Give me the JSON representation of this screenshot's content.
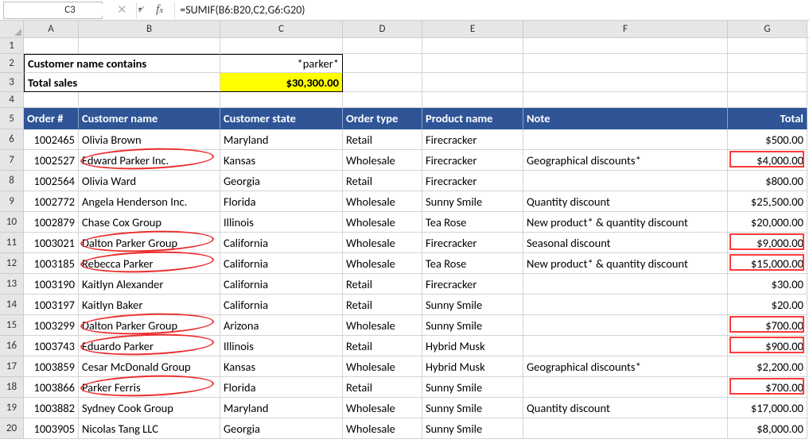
{
  "namebox": "C3",
  "formula": "=SUMIF(B6:B20,C2,G6:G20)",
  "colHeaders": [
    "A",
    "B",
    "C",
    "D",
    "E",
    "F",
    "G"
  ],
  "summary": {
    "label1": "Customer name contains",
    "value1": "*parker*",
    "label2": "Total sales",
    "value2": "$30,300.00"
  },
  "tableHeader": {
    "order": "Order #",
    "customer": "Customer name",
    "state": "Customer state",
    "type": "Order type",
    "product": "Product name",
    "note": "Note",
    "total": "Total"
  },
  "rows": [
    {
      "r": 6,
      "order": "1002465",
      "customer": "Olivia Brown",
      "state": "Maryland",
      "type": "Retail",
      "product": "Firecracker",
      "note": "",
      "total": "$500.00"
    },
    {
      "r": 7,
      "order": "1002527",
      "customer": "Edward Parker Inc.",
      "state": "Kansas",
      "type": "Wholesale",
      "product": "Firecracker",
      "note": "Geographical discounts*",
      "total": "$4,000.00",
      "ovCust": true,
      "ovTotal": true
    },
    {
      "r": 8,
      "order": "1002564",
      "customer": "Olivia Ward",
      "state": "Georgia",
      "type": "Retail",
      "product": "Firecracker",
      "note": "",
      "total": "$800.00"
    },
    {
      "r": 9,
      "order": "1002772",
      "customer": "Angela Henderson Inc.",
      "state": "Florida",
      "type": "Wholesale",
      "product": "Sunny Smile",
      "note": "Quantity discount",
      "total": "$25,500.00"
    },
    {
      "r": 10,
      "order": "1002879",
      "customer": "Chase Cox Group",
      "state": "Illinois",
      "type": "Wholesale",
      "product": "Tea Rose",
      "note": "New product* & quantity discount",
      "total": "$20,000.00"
    },
    {
      "r": 11,
      "order": "1003021",
      "customer": "Dalton Parker Group",
      "state": "California",
      "type": "Wholesale",
      "product": "Firecracker",
      "note": "Seasonal discount",
      "total": "$9,000.00",
      "ovCust": true,
      "ovTotal": true
    },
    {
      "r": 12,
      "order": "1003185",
      "customer": "Rebecca Parker",
      "state": "California",
      "type": "Wholesale",
      "product": "Tea Rose",
      "note": "New product* & quantity discount",
      "total": "$15,000.00",
      "ovCust": true,
      "ovTotal": true
    },
    {
      "r": 13,
      "order": "1003190",
      "customer": "Kaitlyn Alexander",
      "state": "California",
      "type": "Retail",
      "product": "Firecracker",
      "note": "",
      "total": "$30.00"
    },
    {
      "r": 14,
      "order": "1003197",
      "customer": "Kaitlyn Baker",
      "state": "California",
      "type": "Retail",
      "product": "Sunny Smile",
      "note": "",
      "total": "$20.00"
    },
    {
      "r": 15,
      "order": "1003299",
      "customer": "Dalton Parker Group",
      "state": "Arizona",
      "type": "Wholesale",
      "product": "Sunny Smile",
      "note": "",
      "total": "$700.00",
      "ovCust": true,
      "ovTotal": true
    },
    {
      "r": 16,
      "order": "1003743",
      "customer": "Eduardo Parker",
      "state": "Illinois",
      "type": "Retail",
      "product": "Hybrid Musk",
      "note": "",
      "total": "$900.00",
      "ovCust": true,
      "ovTotal": true
    },
    {
      "r": 17,
      "order": "1003859",
      "customer": "Cesar McDonald Group",
      "state": "Kansas",
      "type": "Wholesale",
      "product": "Hybrid Musk",
      "note": "Geographical discounts*",
      "total": "$2,200.00"
    },
    {
      "r": 18,
      "order": "1003866",
      "customer": "Parker Ferris",
      "state": "Florida",
      "type": "Retail",
      "product": "Sunny Smile",
      "note": "",
      "total": "$700.00",
      "ovCust": true,
      "ovTotal": true
    },
    {
      "r": 19,
      "order": "1003882",
      "customer": "Sydney Cook Group",
      "state": "Maryland",
      "type": "Wholesale",
      "product": "Sunny Smile",
      "note": "Quantity discount",
      "total": "$17,000.00"
    },
    {
      "r": 20,
      "order": "1003905",
      "customer": "Nicolas Tang LLC",
      "state": "Georgia",
      "type": "Wholesale",
      "product": "Sunny Smile",
      "note": "",
      "total": "$8,000.00"
    }
  ]
}
